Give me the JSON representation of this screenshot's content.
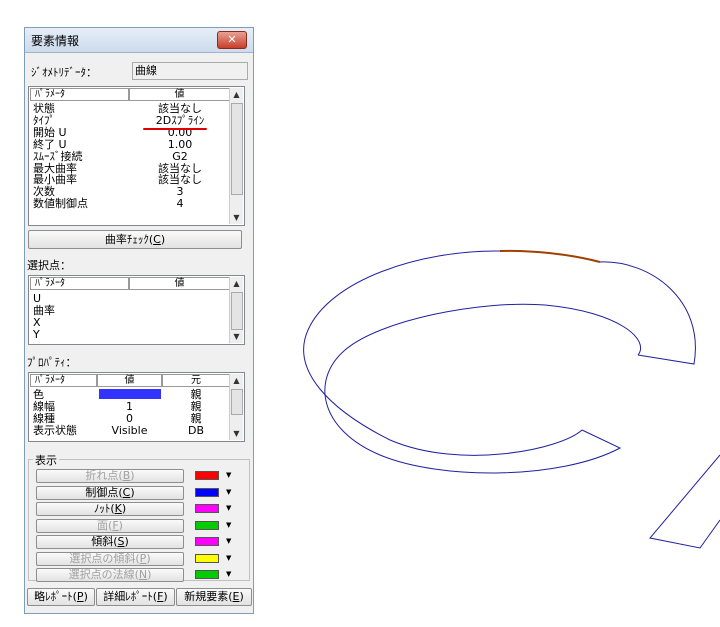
{
  "window": {
    "title": "要素情報",
    "close": "✕"
  },
  "geometry": {
    "label": "ｼﾞｵﾒﾄﾘﾃﾞｰﾀ：",
    "value": "曲線"
  },
  "params": {
    "headers": [
      "ﾊﾟﾗﾒｰﾀ",
      "値"
    ],
    "rows": [
      {
        "name": "状態",
        "value": "該当なし"
      },
      {
        "name": "ﾀｲﾌﾟ",
        "value": "2Dｽﾌﾟﾗｲﾝ"
      },
      {
        "name": "開始 U",
        "value": "0.00"
      },
      {
        "name": "終了 U",
        "value": "1.00"
      },
      {
        "name": "ｽﾑｰｽﾞ接続",
        "value": "G2"
      },
      {
        "name": "最大曲率",
        "value": "該当なし"
      },
      {
        "name": "最小曲率",
        "value": "該当なし"
      },
      {
        "name": "次数",
        "value": "3"
      },
      {
        "name": "数値制御点",
        "value": "4"
      }
    ]
  },
  "curvature_button": {
    "label": "曲率ﾁｪｯｸ(",
    "key": "C",
    "suffix": ")"
  },
  "selected_point": {
    "label": "選択点：",
    "headers": [
      "ﾊﾟﾗﾒｰﾀ",
      "値"
    ],
    "rows": [
      "U",
      "曲率",
      "X",
      "Y"
    ]
  },
  "property": {
    "label": "ﾌﾟﾛﾊﾟﾃｨ：",
    "headers": [
      "ﾊﾟﾗﾒｰﾀ",
      "値",
      "元"
    ],
    "rows": [
      {
        "name": "色",
        "value": "",
        "source": "親"
      },
      {
        "name": "線幅",
        "value": "1",
        "source": "親"
      },
      {
        "name": "線種",
        "value": "0",
        "source": "親"
      },
      {
        "name": "表示状態",
        "value": "Visible",
        "source": "DB"
      }
    ],
    "color_value": "#3333ff"
  },
  "display": {
    "label": "表示",
    "items": [
      {
        "label": "折れ点(",
        "key": "B",
        "suffix": ")",
        "enabled": false,
        "color": "#ff0000"
      },
      {
        "label": "制御点(",
        "key": "C",
        "suffix": ")",
        "enabled": true,
        "color": "#0000ff"
      },
      {
        "label": "ﾉｯﾄ(",
        "key": "K",
        "suffix": ")",
        "enabled": true,
        "color": "#ff00ff"
      },
      {
        "label": "面(",
        "key": "F",
        "suffix": ")",
        "enabled": false,
        "color": "#00cc00"
      },
      {
        "label": "傾斜(",
        "key": "S",
        "suffix": ")",
        "enabled": true,
        "color": "#ff00ff"
      },
      {
        "label": "選択点の傾斜(",
        "key": "P",
        "suffix": ")",
        "enabled": false,
        "color": "#ffff00"
      },
      {
        "label": "選択点の法線(",
        "key": "N",
        "suffix": ")",
        "enabled": false,
        "color": "#00cc00"
      }
    ]
  },
  "footer": [
    {
      "label": "略ﾚﾎﾟｰﾄ(",
      "key": "P",
      "suffix": ")"
    },
    {
      "label": "詳細ﾚﾎﾟｰﾄ(",
      "key": "F",
      "suffix": ")"
    },
    {
      "label": "新規要素(",
      "key": "E",
      "suffix": ")"
    }
  ],
  "colors": {
    "curve": "#2020a0",
    "highlight": "#a04000",
    "underline": "#e00000"
  }
}
